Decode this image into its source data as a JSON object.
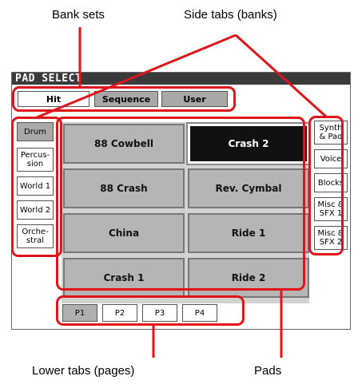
{
  "callouts": {
    "bank_sets": "Bank sets",
    "side_tabs": "Side tabs (banks)",
    "lower_tabs": "Lower tabs (pages)",
    "pads": "Pads"
  },
  "window": {
    "title": "PAD SELECT"
  },
  "bank_sets": [
    {
      "label": "Hit",
      "selected": true
    },
    {
      "label": "Sequence",
      "selected": false
    },
    {
      "label": "User",
      "selected": false
    }
  ],
  "left_tabs": [
    {
      "label": "Drum",
      "selected": true
    },
    {
      "label": "Percus-\nsion",
      "selected": false
    },
    {
      "label": "World 1",
      "selected": false
    },
    {
      "label": "World 2",
      "selected": false
    },
    {
      "label": "Orche-\nstral",
      "selected": false
    }
  ],
  "right_tabs": [
    {
      "label": "Synth\n& Pad"
    },
    {
      "label": "Voice"
    },
    {
      "label": "Blocks"
    },
    {
      "label": "Misc &\nSFX 1"
    },
    {
      "label": "Misc &\nSFX 2"
    }
  ],
  "pads": [
    {
      "label": "88 Cowbell",
      "selected": false
    },
    {
      "label": "Crash 2",
      "selected": true
    },
    {
      "label": "88 Crash",
      "selected": false
    },
    {
      "label": "Rev. Cymbal",
      "selected": false
    },
    {
      "label": "China",
      "selected": false
    },
    {
      "label": "Ride 1",
      "selected": false
    },
    {
      "label": "Crash 1",
      "selected": false
    },
    {
      "label": "Ride 2",
      "selected": false
    }
  ],
  "lower_tabs": [
    {
      "label": "P1",
      "selected": true
    },
    {
      "label": "P2",
      "selected": false
    },
    {
      "label": "P3",
      "selected": false
    },
    {
      "label": "P4",
      "selected": false
    }
  ],
  "colors": {
    "highlight": "#e0151b",
    "titlebar": "#3a3a3a",
    "pad": "#b5b5b5"
  }
}
